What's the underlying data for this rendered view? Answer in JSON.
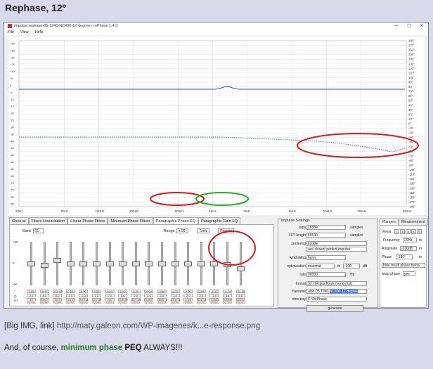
{
  "post": {
    "title": "Rephase, 12º",
    "caption_prefix": "[Big IMG, link]",
    "link_text": "http://maty.galeon.com/WP-imagenes/k...e-response.png",
    "footer_text1": "And, of course, ",
    "footer_green": "minimum phase",
    "footer_space": " ",
    "footer_bold": "PEQ",
    "footer_text2": " ALWAYS!!!"
  },
  "window": {
    "title": "impulse.rephase-05-1240-NC400-12-degree   -   rePhase 1.4.3",
    "controls": [
      "—",
      "▢",
      "✕"
    ],
    "menu": [
      "File",
      "View",
      "Help"
    ]
  },
  "chart": {
    "x_ticks": [
      "20Hz",
      "50Hz",
      "100Hz",
      "200Hz",
      "500Hz",
      "1kHz",
      "2kHz",
      "5kHz",
      "10kHz",
      "20kHz",
      "50kHz"
    ],
    "y_ticks": [
      "180°",
      "170°",
      "160°",
      "150°",
      "140°",
      "130°",
      "120°",
      "110°",
      "100°",
      "90°",
      "80°",
      "70°",
      "60°",
      "50°",
      "40°",
      "30°",
      "20°",
      "10°",
      "0°",
      "-10°",
      "-20°",
      "-30°",
      "-40°",
      "-50°",
      "-60°",
      "-70°",
      "-80°",
      "-90°",
      "-100°",
      "-110°",
      "-120°",
      "-130°",
      "-140°",
      "-150°",
      "-160°",
      "-170°",
      "-180°"
    ],
    "left_labels": [
      "+30",
      "+25",
      "+20",
      "+15",
      "+10",
      "+5",
      "0",
      "-5",
      "-10",
      "-15",
      "-20",
      "-25",
      "-30",
      "-35",
      "-40",
      "-45",
      "-50",
      "-55",
      "-60",
      "-65",
      "-70",
      "-75",
      "-80",
      "-85"
    ]
  },
  "tabs": [
    "General",
    "Filters Linearization",
    "Linear-Phase Filters",
    "Minimum-Phase Filters",
    "Paragraphic Phase EQ",
    "Paragraphic Gain EQ"
  ],
  "eq": {
    "bank_label": "Bank",
    "bank_value": "01",
    "range_label": "Range",
    "range_value": "± 90°",
    "tools_label": "Tools",
    "presets_label": "Presets",
    "scale": [
      "+90",
      "0",
      "-90"
    ],
    "row_labels": [
      "°",
      "Q",
      "Hz"
    ],
    "bypass_label": "bypass",
    "bands": [
      {
        "deg": "0.00",
        "q": "2.0",
        "hz": "40",
        "level": 0.5
      },
      {
        "deg": "-6.47",
        "q": "4.0",
        "hz": "1400",
        "level": 0.46
      },
      {
        "deg": "+12.40",
        "q": "6.0",
        "hz": "1700",
        "level": 0.58
      },
      {
        "deg": "0.00",
        "q": "2.0",
        "hz": "63.0",
        "level": 0.5
      },
      {
        "deg": "0.00",
        "q": "2.0",
        "hz": "89.212",
        "level": 0.5
      },
      {
        "deg": "0.00",
        "q": "2.0",
        "hz": "107.49",
        "level": 0.5
      },
      {
        "deg": "0.00",
        "q": "2.0",
        "hz": "250",
        "level": 0.5
      },
      {
        "deg": "0.00",
        "q": "2.0",
        "hz": "398.00",
        "level": 0.5
      },
      {
        "deg": "0.00",
        "q": "2.0",
        "hz": "629.88",
        "level": 0.5
      },
      {
        "deg": "0.00",
        "q": "2.0",
        "hz": "1000",
        "level": 0.5
      },
      {
        "deg": "0.00",
        "q": "2.0",
        "hz": "1587.4",
        "level": 0.5
      },
      {
        "deg": "0.00",
        "q": "2.0",
        "hz": "2519.5",
        "level": 0.5
      },
      {
        "deg": "0.00",
        "q": "2.0",
        "hz": "4000",
        "level": 0.5
      },
      {
        "deg": "0.00",
        "q": "2.0",
        "hz": "6349.6",
        "level": 0.5
      },
      {
        "deg": "-2.12",
        "q": "1.6",
        "hz": "10080",
        "level": 0.49
      },
      {
        "deg": "-4.24",
        "q": "0.6",
        "hz": "20000",
        "level": 0.48
      },
      {
        "deg": "-24.35",
        "q": "1.5",
        "hz": "40000",
        "level": 0.37
      }
    ]
  },
  "impulse": {
    "legend": "Impulse Settings",
    "taps_label": "taps",
    "taps_value": "16384",
    "taps_unit": "samples",
    "fft_label": "FFT length",
    "fft_value": "65536",
    "fft_unit": "samples",
    "centering_label": "centering",
    "centering_value1": "middle",
    "centering_value2": "use closest perfect impulse",
    "windowing_label": "windowing",
    "windowing_value": "hann",
    "optimization_label": "optimization",
    "optimization_value": "maximal",
    "optimization_to": "to",
    "optimization_db": "-100",
    "optimization_unit": "dB",
    "rate_label": "rate",
    "rate_value": "96000",
    "rate_unit": "Hz",
    "format_label": "format",
    "format_value": "32 / 64 bits floats mono (.txt)",
    "filename_label": "filename",
    "filename_value1": "ulse-05-1240-",
    "filename_value2": "NC400-12-degree",
    "directory_label": "directory",
    "directory_value": "C:\\RePhase",
    "generate_label": "generate"
  },
  "ranges": {
    "tab1": "Ranges",
    "tab2": "Measurement",
    "views_label": "Views",
    "views": [
      "1",
      "2",
      "3",
      "4",
      "5"
    ],
    "frequency_label": "Frequency",
    "frequency_value": "20Hz",
    "frequency_to": "to",
    "amplitude_label": "Amplitude",
    "amplitude_value": "-100dB",
    "amplitude_to": "to",
    "phase_label": "Phase",
    "phase_value": "-180°",
    "phase_to": "to",
    "hide_label": "hide result phase below",
    "wrap_label": "wrap phase",
    "wrap_value": "yes"
  },
  "colors": {
    "annotation_red": "#e0171a",
    "annotation_green": "#21b02a",
    "magnitude_line": "#1f3fbf",
    "phase_line": "#3a5fd0"
  }
}
